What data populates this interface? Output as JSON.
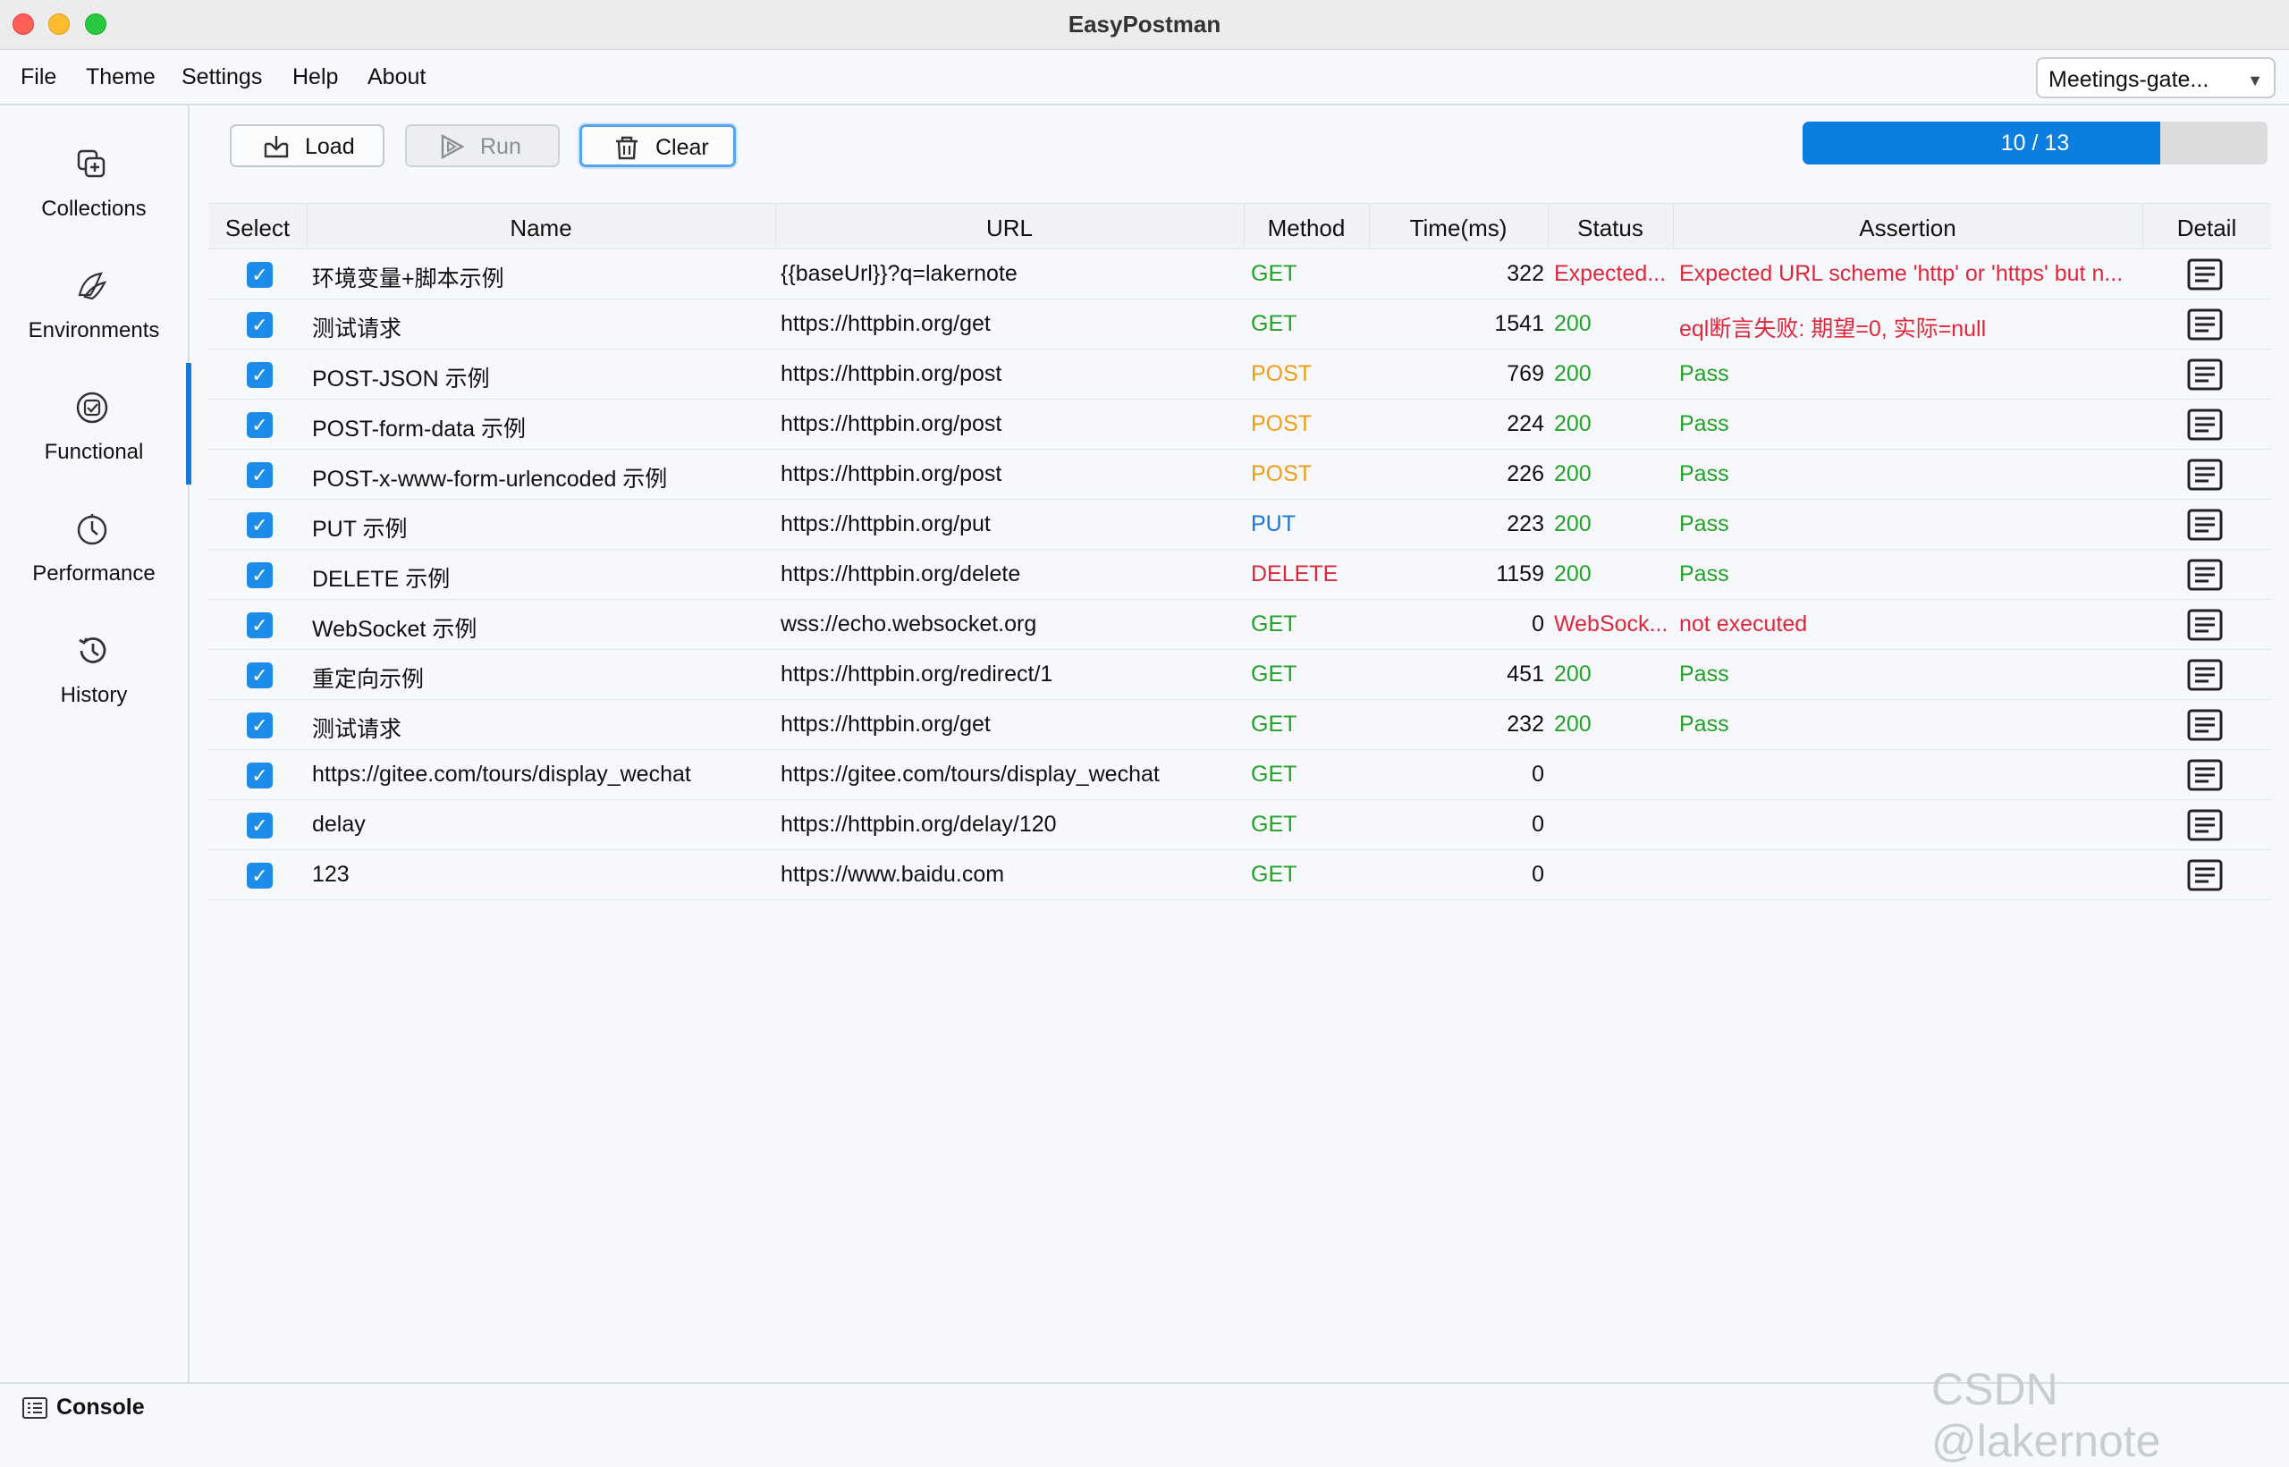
{
  "window": {
    "title": "EasyPostman"
  },
  "menu": {
    "items": [
      "File",
      "Theme",
      "Settings",
      "Help",
      "About"
    ]
  },
  "workspace": {
    "selected": "Meetings-gate..."
  },
  "sidebar": {
    "items": [
      {
        "label": "Collections",
        "icon": "collections-icon"
      },
      {
        "label": "Environments",
        "icon": "environments-icon"
      },
      {
        "label": "Functional",
        "icon": "functional-icon",
        "active": true
      },
      {
        "label": "Performance",
        "icon": "performance-icon"
      },
      {
        "label": "History",
        "icon": "history-icon"
      }
    ]
  },
  "toolbar": {
    "load": "Load",
    "run": "Run",
    "clear": "Clear"
  },
  "progress": {
    "text": "10 / 13",
    "value": 10,
    "max": 13
  },
  "table": {
    "columns": [
      "Select",
      "Name",
      "URL",
      "Method",
      "Time(ms)",
      "Status",
      "Assertion",
      "Detail"
    ],
    "rows": [
      {
        "name": "环境变量+脚本示例",
        "url": "{{baseUrl}}?q=lakernote",
        "method": "GET",
        "time": "322",
        "status": "Expected...",
        "assertion": "Expected URL scheme 'http' or 'https' but n..."
      },
      {
        "name": "测试请求",
        "url": "https://httpbin.org/get",
        "method": "GET",
        "time": "1541",
        "status": "200",
        "assertion": "eql断言失败: 期望=0, 实际=null"
      },
      {
        "name": "POST-JSON 示例",
        "url": "https://httpbin.org/post",
        "method": "POST",
        "time": "769",
        "status": "200",
        "assertion": "Pass"
      },
      {
        "name": "POST-form-data 示例",
        "url": "https://httpbin.org/post",
        "method": "POST",
        "time": "224",
        "status": "200",
        "assertion": "Pass"
      },
      {
        "name": "POST-x-www-form-urlencoded 示例",
        "url": "https://httpbin.org/post",
        "method": "POST",
        "time": "226",
        "status": "200",
        "assertion": "Pass"
      },
      {
        "name": "PUT 示例",
        "url": "https://httpbin.org/put",
        "method": "PUT",
        "time": "223",
        "status": "200",
        "assertion": "Pass"
      },
      {
        "name": "DELETE 示例",
        "url": "https://httpbin.org/delete",
        "method": "DELETE",
        "time": "1159",
        "status": "200",
        "assertion": "Pass"
      },
      {
        "name": "WebSocket 示例",
        "url": "wss://echo.websocket.org",
        "method": "GET",
        "time": "0",
        "status": "WebSock...",
        "assertion": "not executed"
      },
      {
        "name": "重定向示例",
        "url": "https://httpbin.org/redirect/1",
        "method": "GET",
        "time": "451",
        "status": "200",
        "assertion": "Pass"
      },
      {
        "name": "测试请求",
        "url": "https://httpbin.org/get",
        "method": "GET",
        "time": "232",
        "status": "200",
        "assertion": "Pass"
      },
      {
        "name": "https://gitee.com/tours/display_wechat",
        "url": "https://gitee.com/tours/display_wechat",
        "method": "GET",
        "time": "0",
        "status": "",
        "assertion": ""
      },
      {
        "name": "delay",
        "url": "https://httpbin.org/delay/120",
        "method": "GET",
        "time": "0",
        "status": "",
        "assertion": ""
      },
      {
        "name": "123",
        "url": "https://www.baidu.com",
        "method": "GET",
        "time": "0",
        "status": "",
        "assertion": ""
      }
    ]
  },
  "colors": {
    "accent": "#1677d8",
    "pass": "#22a22a",
    "fail": "#e0263b",
    "post": "#f39c12",
    "progress": "#0b7ee0"
  },
  "statusbar": {
    "console": "Console"
  },
  "watermark": "CSDN @lakernote"
}
